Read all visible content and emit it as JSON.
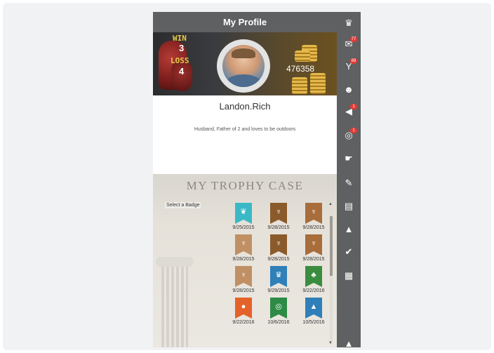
{
  "header": {
    "title": "My Profile"
  },
  "stats": {
    "win_label": "WIN",
    "win_value": "3",
    "loss_label": "LOSS",
    "loss_value": "4",
    "coins": "476358"
  },
  "profile": {
    "name": "Landon.Rich",
    "bio": "Husband, Father of 2 and loves to be outdoors"
  },
  "trophy_case": {
    "title": "MY TROPHY CASE",
    "select_label": "Select a Badge",
    "badges": [
      {
        "date": "9/25/2015",
        "color": "#3bb8c5",
        "icon": "leaf-icon",
        "glyph": "❦"
      },
      {
        "date": "9/28/2015",
        "color": "#8b5a2b",
        "icon": "stag-icon",
        "glyph": "♆"
      },
      {
        "date": "9/28/2015",
        "color": "#a86d3a",
        "icon": "stag-icon",
        "glyph": "♆"
      },
      {
        "date": "9/28/2015",
        "color": "#c09064",
        "icon": "stag-icon",
        "glyph": "♆"
      },
      {
        "date": "9/28/2015",
        "color": "#8b5a2b",
        "icon": "stag-icon",
        "glyph": "♆"
      },
      {
        "date": "9/28/2015",
        "color": "#a86d3a",
        "icon": "stag-icon",
        "glyph": "♆"
      },
      {
        "date": "9/28/2015",
        "color": "#c09064",
        "icon": "stag-icon",
        "glyph": "♆"
      },
      {
        "date": "9/29/2015",
        "color": "#2f7fb8",
        "icon": "trophy-icon",
        "glyph": "♛"
      },
      {
        "date": "9/22/2016",
        "color": "#3a8d3e",
        "icon": "tree-icon",
        "glyph": "♣"
      },
      {
        "date": "9/22/2016",
        "color": "#e4622a",
        "icon": "basketball-icon",
        "glyph": "●"
      },
      {
        "date": "10/6/2016",
        "color": "#2e8b45",
        "icon": "globe-icon",
        "glyph": "◎"
      },
      {
        "date": "10/5/2016",
        "color": "#2f7fb8",
        "icon": "shark-icon",
        "glyph": "▲"
      }
    ]
  },
  "sidebar": {
    "items": [
      {
        "icon": "leaderboard-icon",
        "glyph": "♛",
        "badge": ""
      },
      {
        "icon": "chat-icon",
        "glyph": "✉",
        "badge": "77"
      },
      {
        "icon": "cocktail-icon",
        "glyph": "Y",
        "badge": "89"
      },
      {
        "icon": "people-icon",
        "glyph": "☻",
        "badge": ""
      },
      {
        "icon": "megaphone-icon",
        "glyph": "◀",
        "badge": "1"
      },
      {
        "icon": "lifebuoy-icon",
        "glyph": "◎",
        "badge": "1"
      },
      {
        "icon": "whistle-icon",
        "glyph": "☛",
        "badge": ""
      },
      {
        "icon": "edit-icon",
        "glyph": "✎",
        "badge": ""
      },
      {
        "icon": "clipboard-icon",
        "glyph": "▤",
        "badge": ""
      },
      {
        "icon": "graduation-cap-icon",
        "glyph": "▲",
        "badge": ""
      },
      {
        "icon": "checklist-icon",
        "glyph": "✔",
        "badge": ""
      },
      {
        "icon": "apps-grid-icon",
        "glyph": "▦",
        "badge": ""
      },
      {
        "icon": "bell-icon",
        "glyph": "▲",
        "badge": ""
      }
    ]
  }
}
